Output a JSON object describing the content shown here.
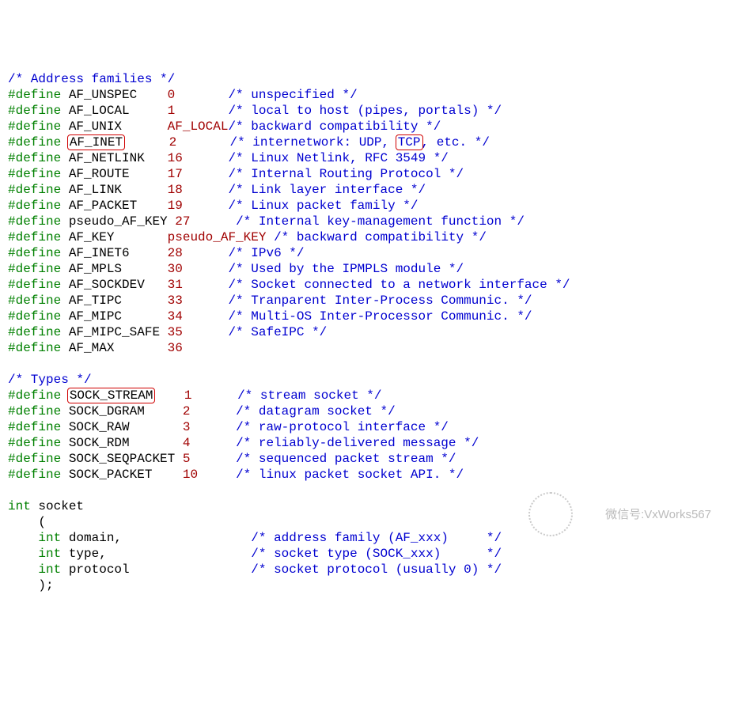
{
  "hdr_af": "/* Address families */",
  "af": [
    {
      "name": "AF_UNSPEC",
      "pad": "    ",
      "val": "0 ",
      "vpad": "      ",
      "c": "/* unspecified */"
    },
    {
      "name": "AF_LOCAL",
      "pad": "     ",
      "val": "1 ",
      "vpad": "      ",
      "c": "/* local to host (pipes, portals) */"
    },
    {
      "name": "AF_UNIX",
      "pad": "      ",
      "val": "AF_LOCAL",
      "vpad": "",
      "c": "/* backward compatibility */",
      "valmacro": true
    },
    {
      "name": "AF_INET",
      "pad": "      ",
      "val": "2 ",
      "vpad": "      ",
      "c_pre": "/* internetwork: UDP, ",
      "c_box": "TCP",
      "c_post": ", etc. */",
      "box": true
    },
    {
      "name": "AF_NETLINK",
      "pad": "   ",
      "val": "16",
      "vpad": "      ",
      "c": "/* Linux Netlink, RFC 3549 */"
    },
    {
      "name": "AF_ROUTE",
      "pad": "     ",
      "val": "17",
      "vpad": "      ",
      "c": "/* Internal Routing Protocol */"
    },
    {
      "name": "AF_LINK",
      "pad": "      ",
      "val": "18",
      "vpad": "      ",
      "c": "/* Link layer interface */"
    },
    {
      "name": "AF_PACKET",
      "pad": "    ",
      "val": "19",
      "vpad": "      ",
      "c": "/* Linux packet family */"
    },
    {
      "name": "pseudo_AF_KEY",
      "pad": " ",
      "val": "27",
      "vpad": "      ",
      "c": "/* Internal key-management function */"
    },
    {
      "name": "AF_KEY",
      "pad": "       ",
      "val": "pseudo_AF_KEY",
      "vpad": " ",
      "c": "/* backward compatibility */",
      "valmacro": true
    },
    {
      "name": "AF_INET6",
      "pad": "     ",
      "val": "28",
      "vpad": "      ",
      "c": "/* IPv6 */"
    },
    {
      "name": "AF_MPLS",
      "pad": "      ",
      "val": "30",
      "vpad": "      ",
      "c": "/* Used by the IPMPLS module */"
    },
    {
      "name": "AF_SOCKDEV",
      "pad": "   ",
      "val": "31",
      "vpad": "      ",
      "c": "/* Socket connected to a network interface */"
    },
    {
      "name": "AF_TIPC",
      "pad": "      ",
      "val": "33",
      "vpad": "      ",
      "c": "/* Tranparent Inter-Process Communic. */"
    },
    {
      "name": "AF_MIPC",
      "pad": "      ",
      "val": "34",
      "vpad": "      ",
      "c": "/* Multi-OS Inter-Processor Communic. */"
    },
    {
      "name": "AF_MIPC_SAFE",
      "pad": " ",
      "val": "35",
      "vpad": "      ",
      "c": "/* SafeIPC */"
    },
    {
      "name": "AF_MAX",
      "pad": "       ",
      "val": "36",
      "vpad": "",
      "c": ""
    }
  ],
  "hdr_types": "/* Types */",
  "types": [
    {
      "name": "SOCK_STREAM",
      "pad": "    ",
      "val": "1 ",
      "vpad": "     ",
      "c": "/* stream socket */",
      "box": true
    },
    {
      "name": "SOCK_DGRAM",
      "pad": "     ",
      "val": "2 ",
      "vpad": "     ",
      "c": "/* datagram socket */"
    },
    {
      "name": "SOCK_RAW",
      "pad": "       ",
      "val": "3 ",
      "vpad": "     ",
      "c": "/* raw-protocol interface */"
    },
    {
      "name": "SOCK_RDM",
      "pad": "       ",
      "val": "4 ",
      "vpad": "     ",
      "c": "/* reliably-delivered message */"
    },
    {
      "name": "SOCK_SEQPACKET",
      "pad": " ",
      "val": "5 ",
      "vpad": "     ",
      "c": "/* sequenced packet stream */"
    },
    {
      "name": "SOCK_PACKET",
      "pad": "    ",
      "val": "10",
      "vpad": "     ",
      "c": "/* linux packet socket API. */"
    }
  ],
  "fn": {
    "ret": "int",
    "name": "socket",
    "open": "    (",
    "p1": {
      "t": "int",
      "n": "domain",
      "comma": ",",
      "pad": "                 ",
      "c": "/* address family (AF_xxx)     */"
    },
    "p2": {
      "t": "int",
      "n": "type",
      "comma": ",",
      "pad": "                   ",
      "c": "/* socket type (SOCK_xxx)      */"
    },
    "p3": {
      "t": "int",
      "n": "protocol",
      "comma": "",
      "pad": "                ",
      "c": "/* socket protocol (usually 0) */"
    },
    "close": "    );"
  },
  "define": "#define",
  "watermark": "微信号:VxWorks567"
}
